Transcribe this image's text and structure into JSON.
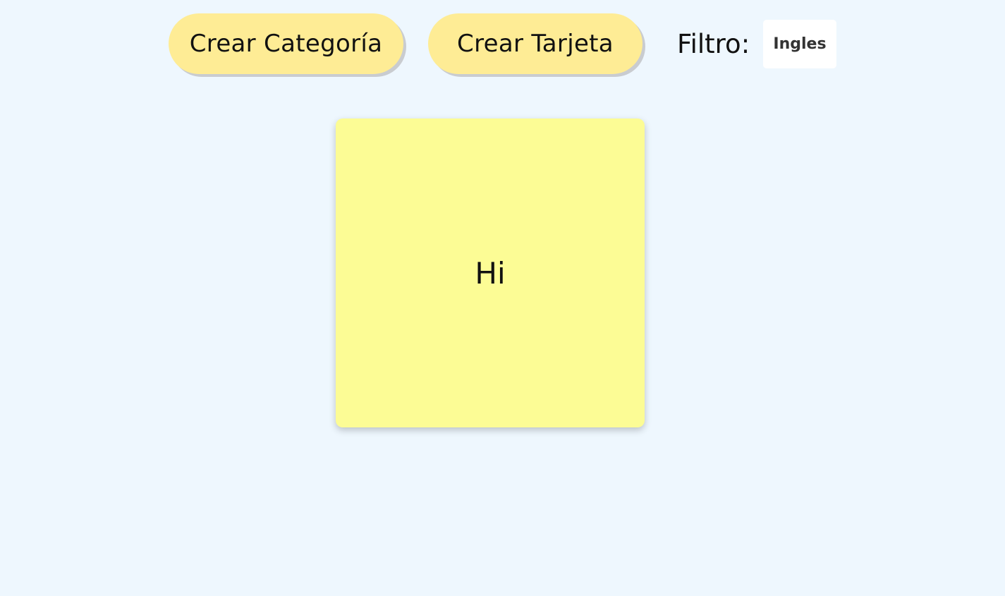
{
  "toolbar": {
    "create_category_label": "Crear Categoría",
    "create_card_label": "Crear Tarjeta",
    "filter_label": "Filtro:",
    "filter_selected": "Ingles"
  },
  "cards": [
    {
      "text": "Hi"
    }
  ],
  "colors": {
    "background": "#eef7fe",
    "button": "#feec95",
    "card": "#fcfc95"
  }
}
